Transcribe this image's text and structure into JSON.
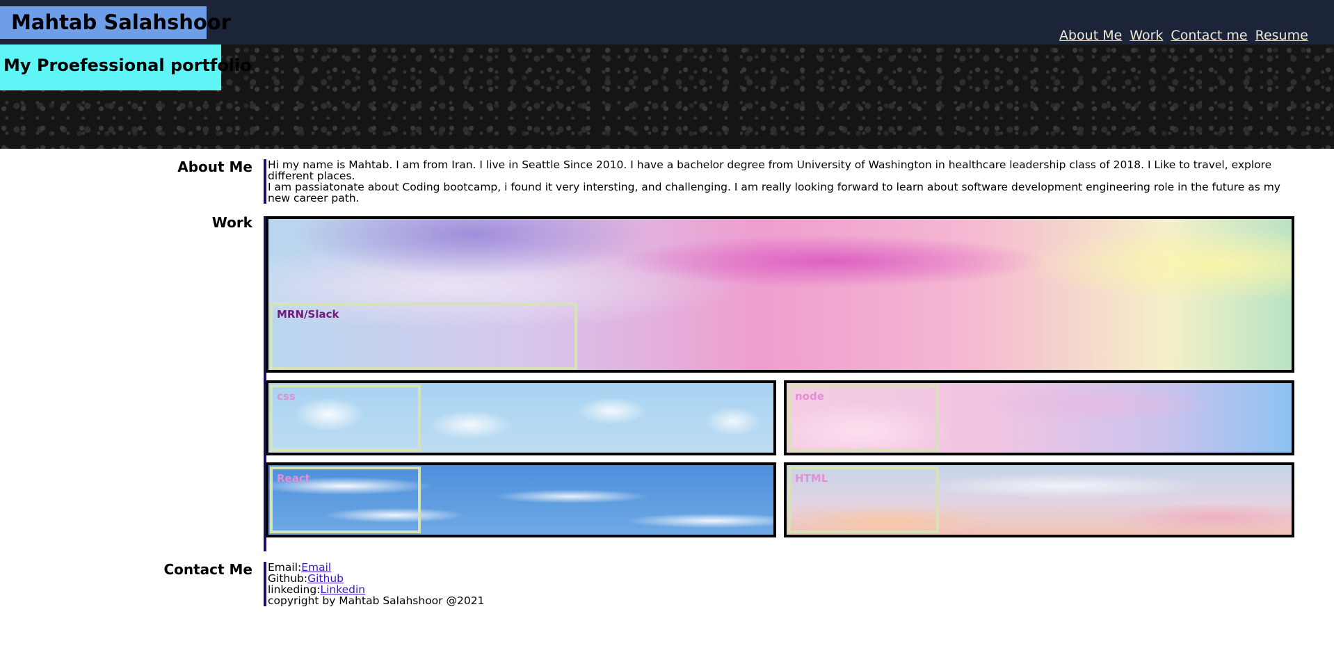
{
  "header": {
    "site_name": "Mahtab Salahshoor",
    "nav": [
      "About Me",
      "Work",
      "Contact me",
      "Resume"
    ]
  },
  "hero": {
    "title": "My Proefessional portfolio"
  },
  "about": {
    "label": "About Me",
    "paragraph_1": "Hi my name is Mahtab. I am from Iran. I live in Seattle Since 2010. I have a bachelor degree from University of Washington in healthcare leadership class of 2018. I Like to travel, explore different places.",
    "paragraph_2": "I am passiatonate about Coding bootcamp, i found it very intersting, and challenging. I am really looking forward to learn about software development engineering role in the future as my new career path."
  },
  "work": {
    "label": "Work",
    "projects": [
      {
        "caption": "MRN/Slack"
      },
      {
        "caption": "css"
      },
      {
        "caption": "node"
      },
      {
        "caption": "React"
      },
      {
        "caption": "HTML"
      }
    ]
  },
  "contact": {
    "label": "Contact Me",
    "email_prefix": "Email:",
    "email_link": "Email",
    "github_prefix": "Github:",
    "github_link": "Github",
    "linkedin_prefix": "linkeding:",
    "linkedin_link": "Linkedin",
    "copyright": "copyright by Mahtab Salahshoor @2021"
  },
  "colors": {
    "topbar": "#1b2438",
    "name_badge": "#6f9ee8",
    "hero_badge": "#5ff5f7",
    "accent_border": "#1d0a6e",
    "nav_link": "#f2ead8",
    "link": "#3d14c8"
  }
}
